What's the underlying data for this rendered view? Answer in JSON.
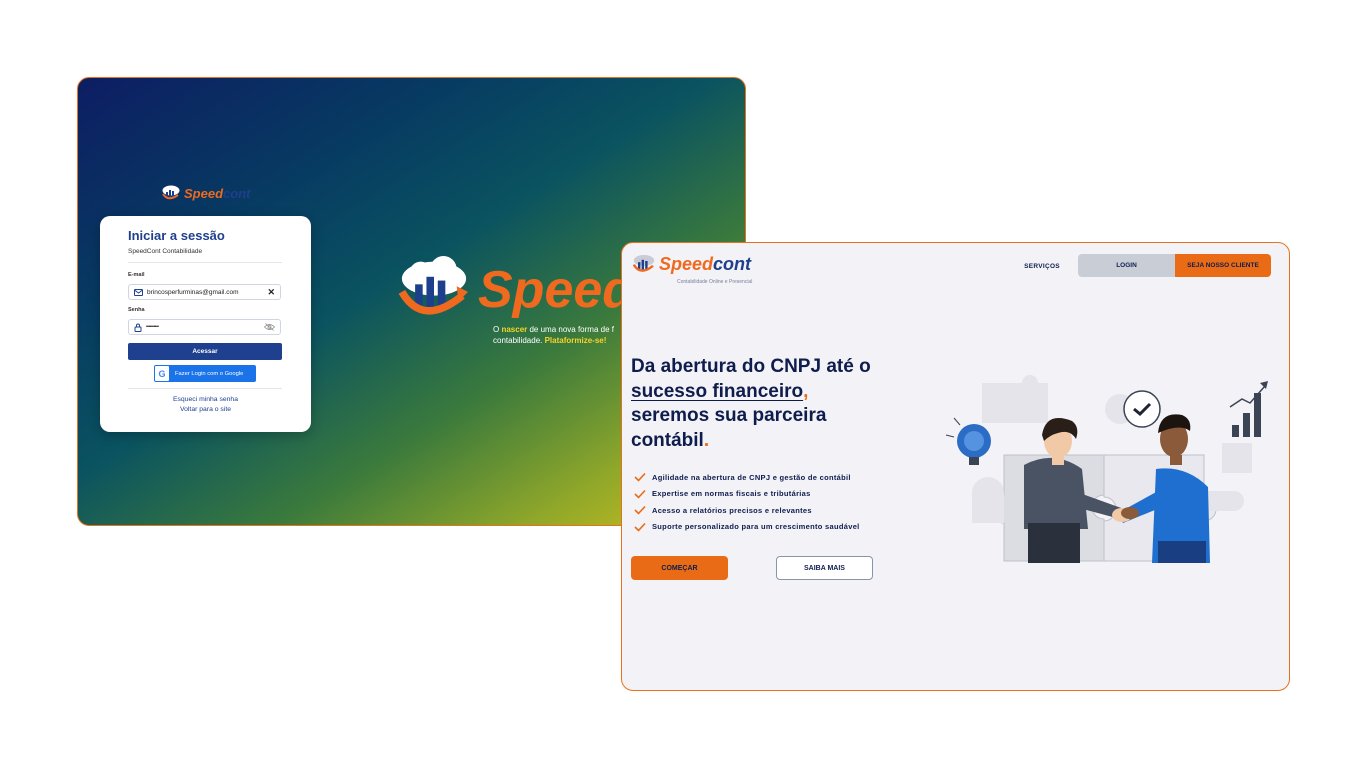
{
  "brand": {
    "logo_speed": "Speed",
    "logo_cont": "cont",
    "logo_tagline": "Contabilidade Online e Presencial"
  },
  "login": {
    "title": "Iniciar a sessão",
    "subtitle": "SpeedCont Contabilidade",
    "email_label": "E-mail",
    "email_value": "brincosperfurminas@gmail.com",
    "password_label": "Senha",
    "password_value": "••••••••••",
    "submit_label": "Acessar",
    "google_label": "Fazer Login com o Google",
    "forgot_label": "Esqueci minha senha",
    "back_label": "Voltar para o site"
  },
  "promo": {
    "tagline_prefix": "O ",
    "tagline_highlight": "nascer",
    "tagline_mid": " de uma nova forma de f",
    "tagline_line2_prefix": "contabilidade. ",
    "tagline_line2_highlight": "Plataformize-se!"
  },
  "site": {
    "nav": {
      "servicos": "SERVIÇOS",
      "login": "LOGIN",
      "cliente": "SEJA NOSSO CLIENTE"
    },
    "hero": {
      "line1": "Da abertura do CNPJ até o",
      "line2_underlined": "sucesso financeiro",
      "line2_punct": ",",
      "line3": "seremos sua parceira",
      "line4": "contábil",
      "line4_punct": "."
    },
    "features": [
      "Agilidade na abertura de CNPJ e gestão de contábil",
      "Expertise em normas fiscais e tributárias",
      "Acesso a relatórios precisos e relevantes",
      "Suporte personalizado para um crescimento saudável"
    ],
    "cta_primary": "COMEÇAR",
    "cta_secondary": "SAIBA MAIS"
  },
  "colors": {
    "accent_orange": "#e96b15",
    "navy": "#0f1d4d",
    "brand_blue": "#1f3f8f",
    "google_blue": "#1a73e8"
  }
}
